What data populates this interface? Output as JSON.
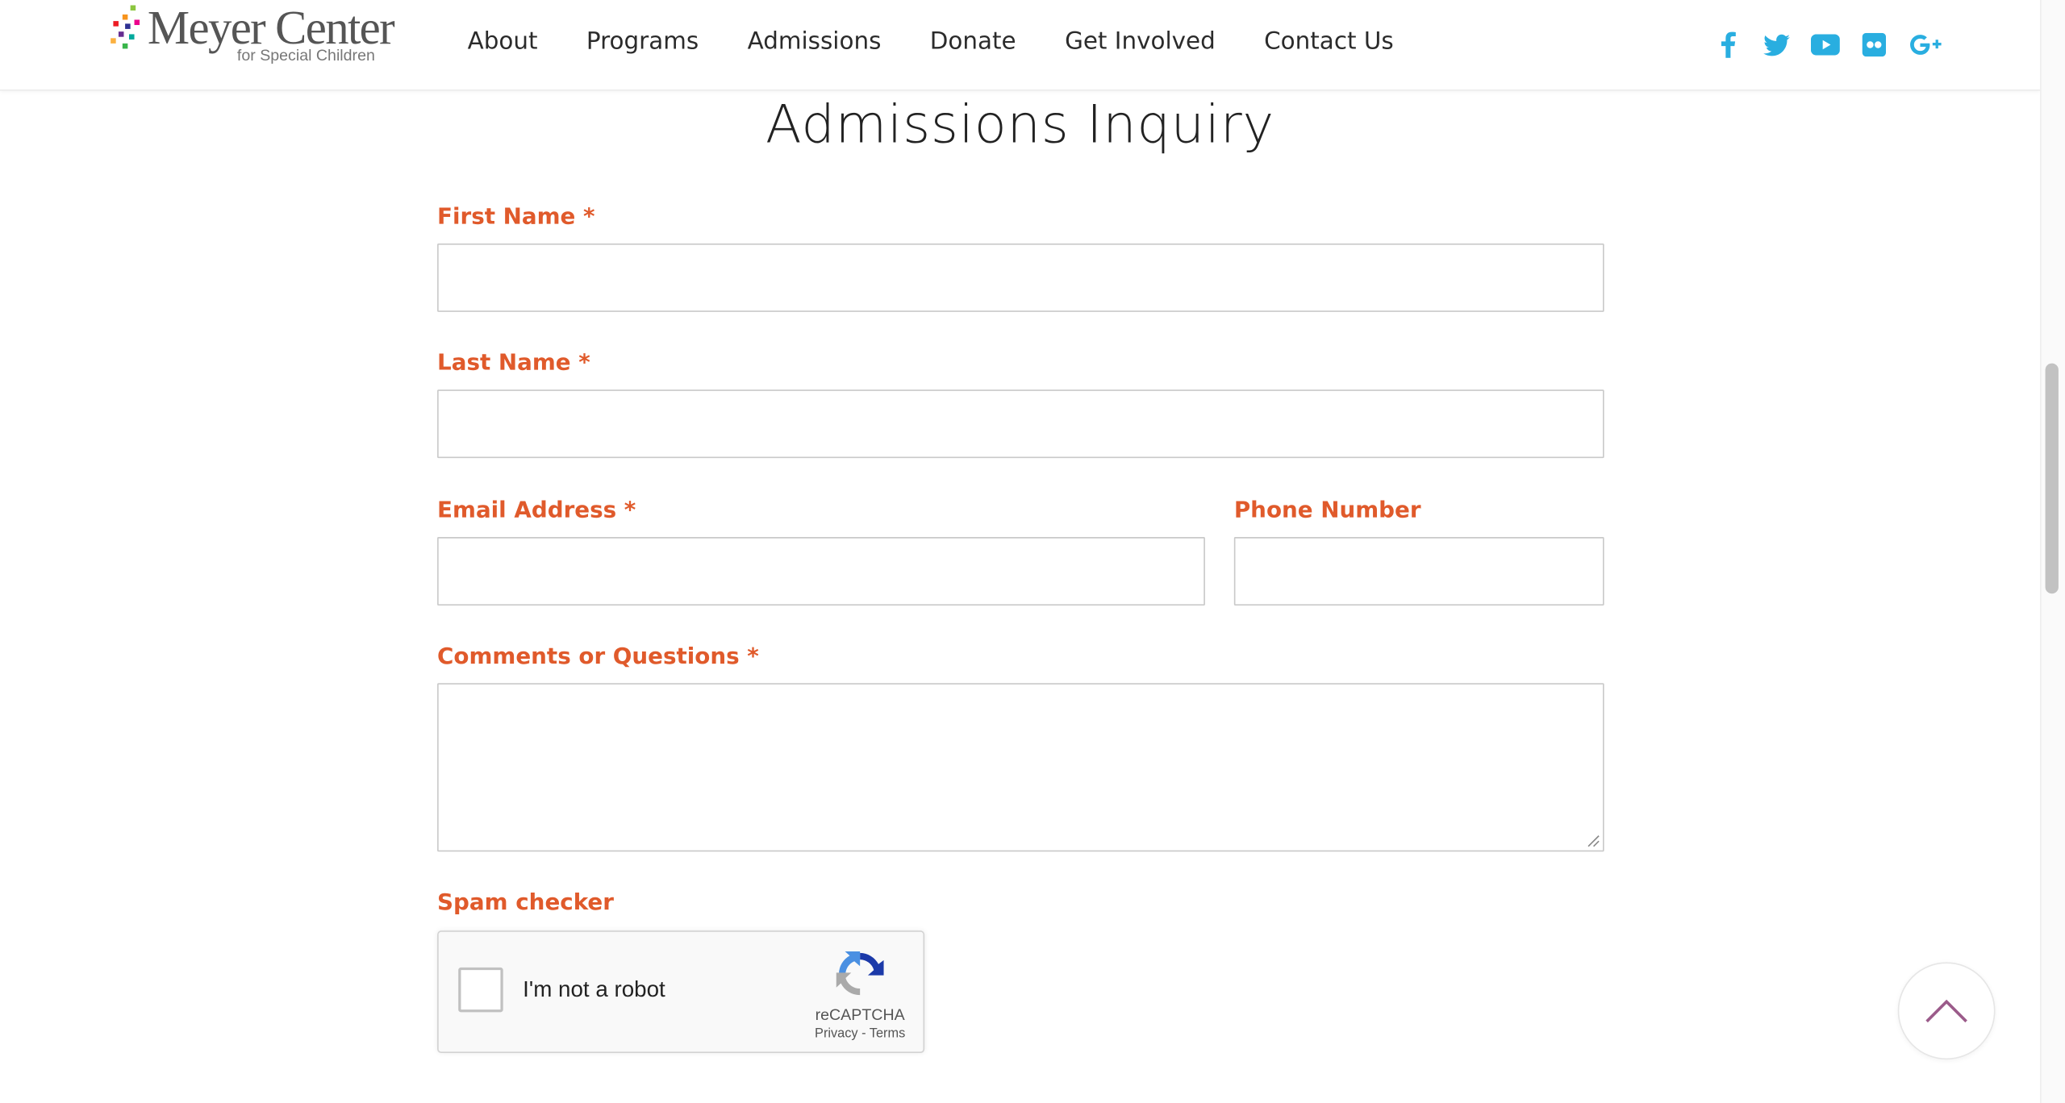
{
  "header": {
    "logo": {
      "title": "Meyer Center",
      "subtitle": "for Special Children"
    },
    "nav": [
      "About",
      "Programs",
      "Admissions",
      "Donate",
      "Get Involved",
      "Contact Us"
    ],
    "social_icons": [
      "facebook-icon",
      "twitter-icon",
      "youtube-icon",
      "flickr-icon",
      "google-plus-icon"
    ],
    "social_color": "#29aee0"
  },
  "form": {
    "title": "Admissions Inquiry",
    "label_color": "#e05a2b",
    "first_name": {
      "label": "First Name *",
      "value": ""
    },
    "last_name": {
      "label": "Last Name *",
      "value": ""
    },
    "email": {
      "label": "Email Address *",
      "value": ""
    },
    "phone": {
      "label": "Phone Number",
      "value": ""
    },
    "comments": {
      "label": "Comments or Questions *",
      "value": ""
    },
    "spam": {
      "label": "Spam checker"
    }
  },
  "captcha": {
    "checkbox_label": "I'm not a robot",
    "brand": "reCAPTCHA",
    "links": "Privacy - Terms"
  },
  "back_to_top": {
    "icon": "chevron-up-icon"
  }
}
